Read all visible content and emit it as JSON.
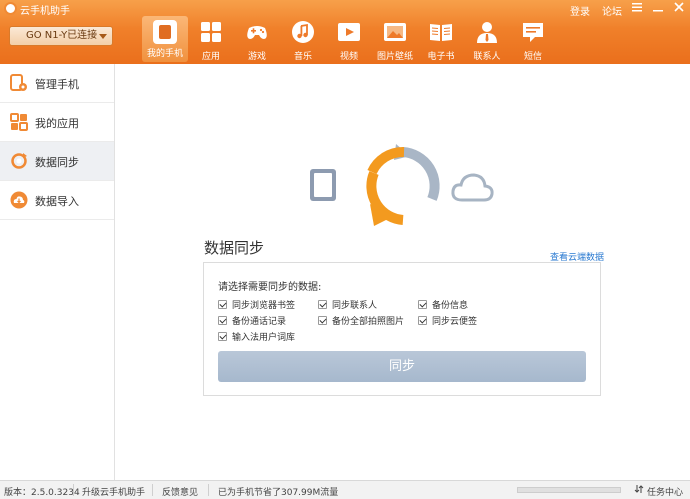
{
  "titlebar": {
    "title": "云手机助手",
    "login": "登录",
    "forum": "论坛",
    "menu_icon": "menu-icon",
    "minimize_icon": "minimize-icon",
    "close_icon": "close-icon"
  },
  "device": {
    "label": "GO N1-Y已连接"
  },
  "nav": {
    "items": [
      {
        "label": "我的手机",
        "icon": "phone-icon"
      },
      {
        "label": "应用",
        "icon": "apps-icon"
      },
      {
        "label": "游戏",
        "icon": "gamepad-icon"
      },
      {
        "label": "音乐",
        "icon": "music-icon"
      },
      {
        "label": "视频",
        "icon": "video-icon"
      },
      {
        "label": "图片壁纸",
        "icon": "picture-icon"
      },
      {
        "label": "电子书",
        "icon": "book-icon"
      },
      {
        "label": "联系人",
        "icon": "contact-icon"
      },
      {
        "label": "短信",
        "icon": "sms-icon"
      }
    ]
  },
  "sidebar": {
    "items": [
      {
        "label": "管理手机",
        "icon": "phone-gear-icon"
      },
      {
        "label": "我的应用",
        "icon": "apps-grid-icon"
      },
      {
        "label": "数据同步",
        "icon": "sync-icon"
      },
      {
        "label": "数据导入",
        "icon": "cloud-import-icon"
      }
    ]
  },
  "main": {
    "title": "数据同步",
    "cloud_link": "查看云端数据",
    "prompt": "请选择需要同步的数据:",
    "options": [
      {
        "label": "同步浏览器书签",
        "checked": true
      },
      {
        "label": "同步联系人",
        "checked": true
      },
      {
        "label": "备份信息",
        "checked": true
      },
      {
        "label": "备份通话记录",
        "checked": true
      },
      {
        "label": "备份全部拍照图片",
        "checked": true
      },
      {
        "label": "同步云便签",
        "checked": true
      },
      {
        "label": "输入法用户词库",
        "checked": true
      }
    ],
    "sync_button": "同步"
  },
  "status": {
    "version": "版本：2.5.0.3234",
    "upgrade": "升级云手机助手",
    "feedback": "反馈意见",
    "saved": "已为手机节省了307.99M流量",
    "task_icon": "download-icon",
    "task_center": "任务中心"
  },
  "colors": {
    "accent": "#f0802a",
    "link": "#2a7ad1",
    "sync_orange": "#f39a1f",
    "sync_gray": "#9aa9bb"
  }
}
